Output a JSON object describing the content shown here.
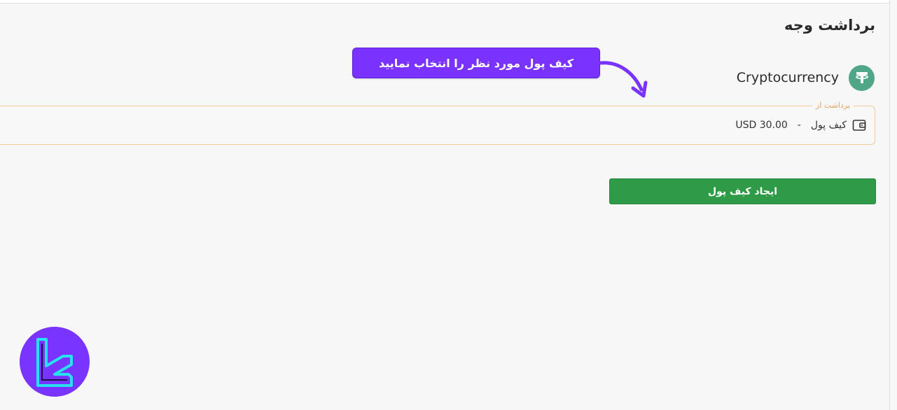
{
  "page": {
    "title": "برداشت وجه"
  },
  "callout": {
    "text": "کیف پول مورد نظر را انتخاب نمایید"
  },
  "method": {
    "label": "Cryptocurrency",
    "icon": "tether-icon",
    "icon_color": "#4fa787"
  },
  "withdraw_from": {
    "legend": "برداشت از",
    "wallet_label": "کیف پول",
    "separator": "-",
    "amount": "USD 30.00",
    "icon": "wallet-icon"
  },
  "actions": {
    "create_wallet": "ایجاد کیف پول",
    "create_wallet_color": "#2f9a47"
  },
  "colors": {
    "accent": "#7a33ff",
    "field_border": "#f0c89a",
    "legend": "#e2a35e"
  }
}
